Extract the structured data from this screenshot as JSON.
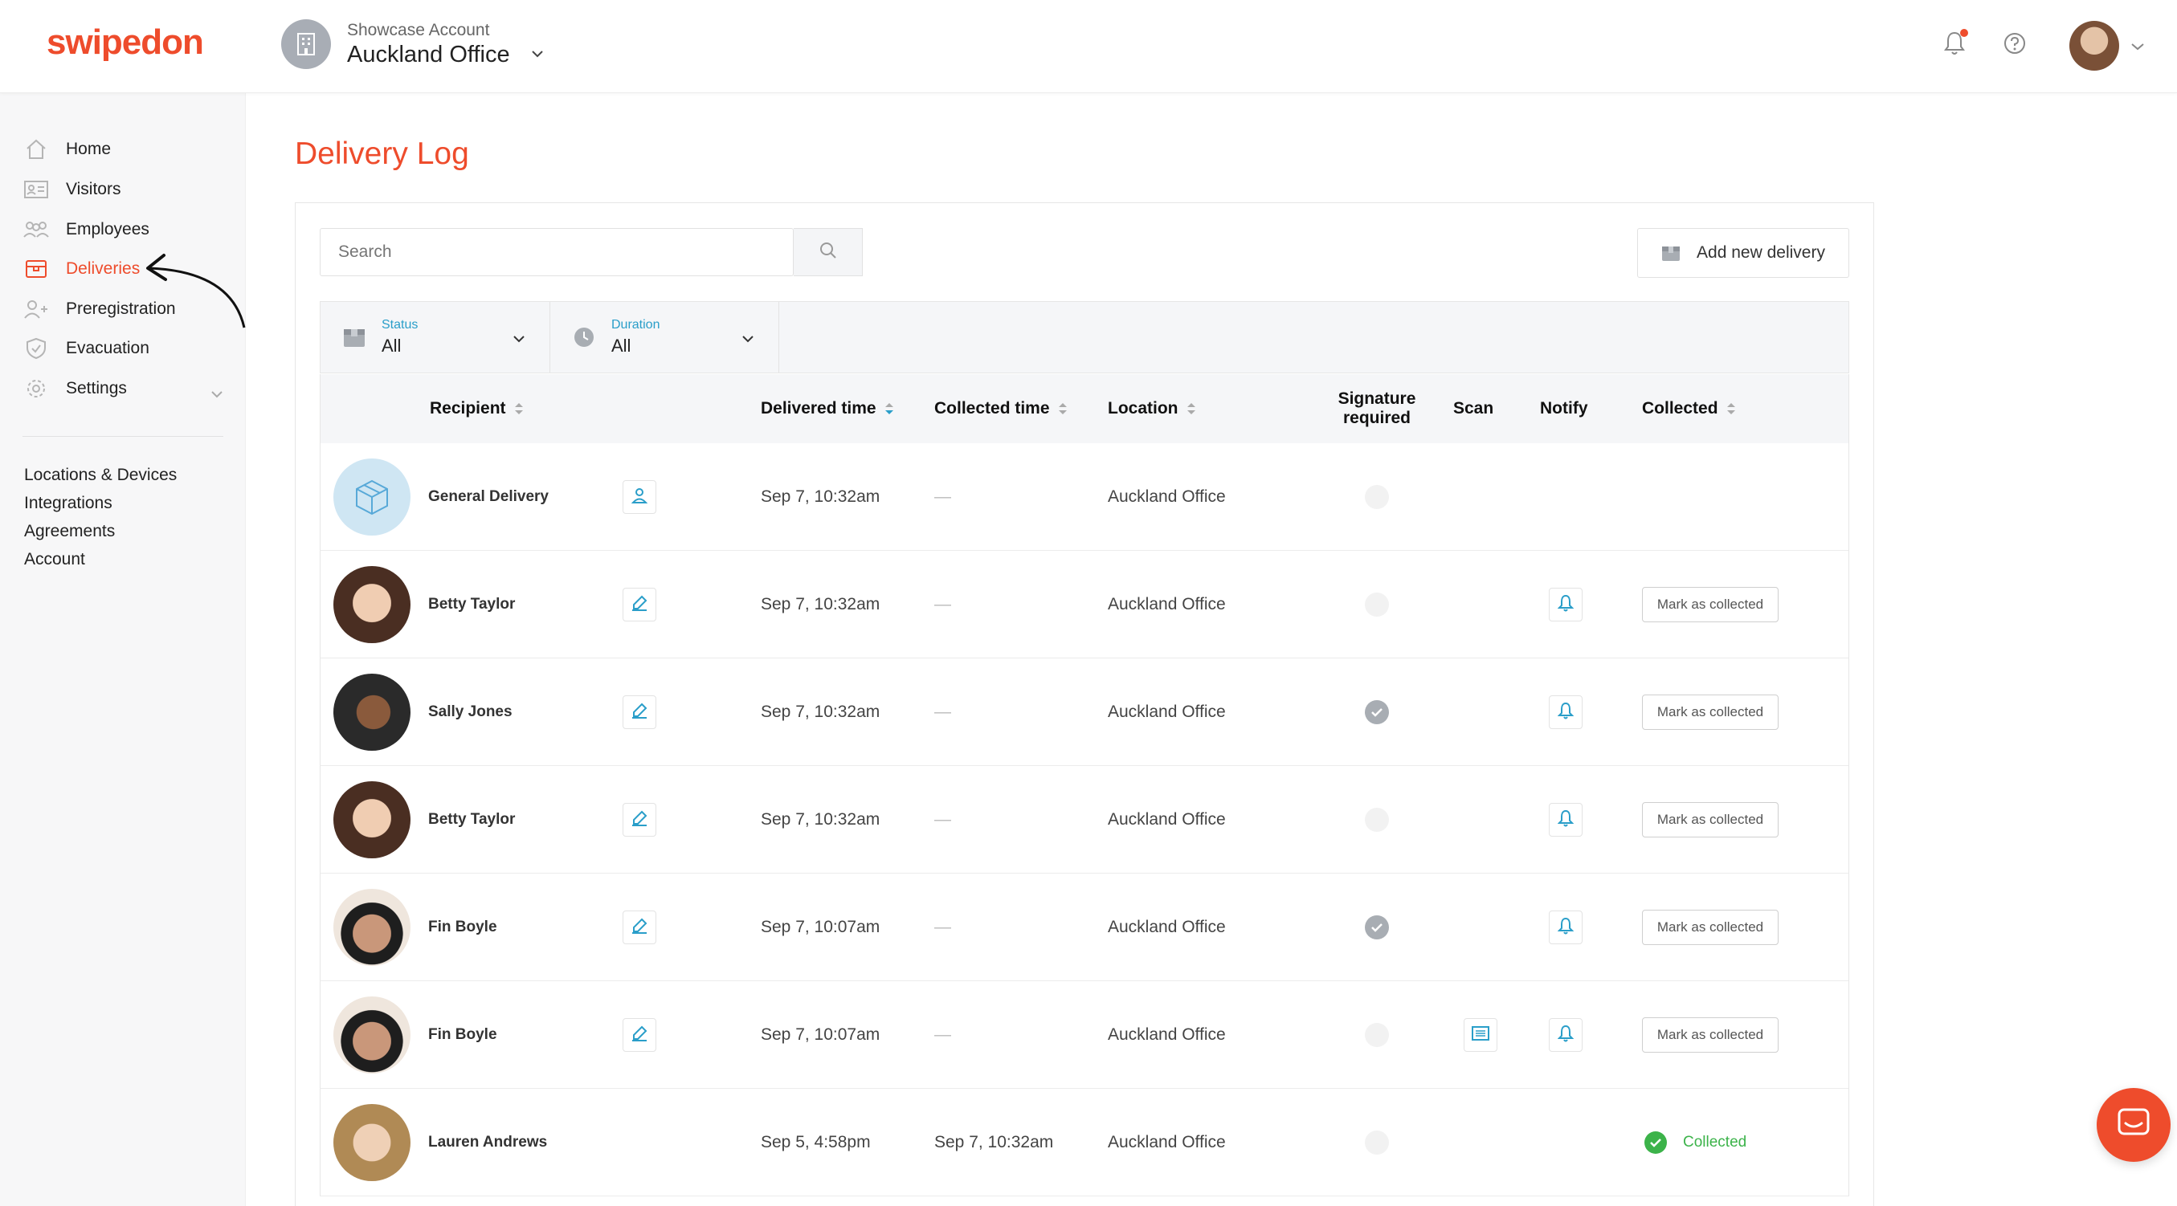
{
  "brand": {
    "name": "swipedon",
    "accent": "#ee4c2c"
  },
  "account": {
    "org": "Showcase Account",
    "location": "Auckland Office"
  },
  "sidebar": {
    "items": [
      {
        "label": "Home",
        "icon": "home-icon"
      },
      {
        "label": "Visitors",
        "icon": "id-card-icon"
      },
      {
        "label": "Employees",
        "icon": "people-icon"
      },
      {
        "label": "Deliveries",
        "icon": "box-icon",
        "active": true
      },
      {
        "label": "Preregistration",
        "icon": "person-add-icon"
      },
      {
        "label": "Evacuation",
        "icon": "shield-icon"
      },
      {
        "label": "Settings",
        "icon": "gear-icon"
      }
    ],
    "links": [
      "Locations & Devices",
      "Integrations",
      "Agreements",
      "Account"
    ]
  },
  "page": {
    "title": "Delivery Log"
  },
  "toolbar": {
    "search_placeholder": "Search",
    "add_label": "Add new delivery"
  },
  "filters": [
    {
      "label": "Status",
      "value": "All"
    },
    {
      "label": "Duration",
      "value": "All"
    }
  ],
  "columns": {
    "recipient": "Recipient",
    "delivered": "Delivered time",
    "collected_time": "Collected time",
    "location": "Location",
    "signature_1": "Signature",
    "signature_2": "required",
    "scan": "Scan",
    "notify": "Notify",
    "collected": "Collected"
  },
  "rows": [
    {
      "name": "General Delivery",
      "delivered": "Sep 7, 10:32am",
      "collected_time": "—",
      "location": "Auckland Office",
      "signature": false
    },
    {
      "name": "Betty Taylor",
      "delivered": "Sep 7, 10:32am",
      "collected_time": "—",
      "location": "Auckland Office",
      "signature": false,
      "mark_label": "Mark as collected"
    },
    {
      "name": "Sally Jones",
      "delivered": "Sep 7, 10:32am",
      "collected_time": "—",
      "location": "Auckland Office",
      "signature": true,
      "mark_label": "Mark as collected"
    },
    {
      "name": "Betty Taylor",
      "delivered": "Sep 7, 10:32am",
      "collected_time": "—",
      "location": "Auckland Office",
      "signature": false,
      "mark_label": "Mark as collected"
    },
    {
      "name": "Fin Boyle",
      "delivered": "Sep 7, 10:07am",
      "collected_time": "—",
      "location": "Auckland Office",
      "signature": true,
      "mark_label": "Mark as collected"
    },
    {
      "name": "Fin Boyle",
      "delivered": "Sep 7, 10:07am",
      "collected_time": "—",
      "location": "Auckland Office",
      "signature": false,
      "scan": true,
      "mark_label": "Mark as collected"
    },
    {
      "name": "Lauren Andrews",
      "delivered": "Sep 5, 4:58pm",
      "collected_time": "Sep 7, 10:32am",
      "location": "Auckland Office",
      "signature": false,
      "collected_label": "Collected"
    }
  ]
}
